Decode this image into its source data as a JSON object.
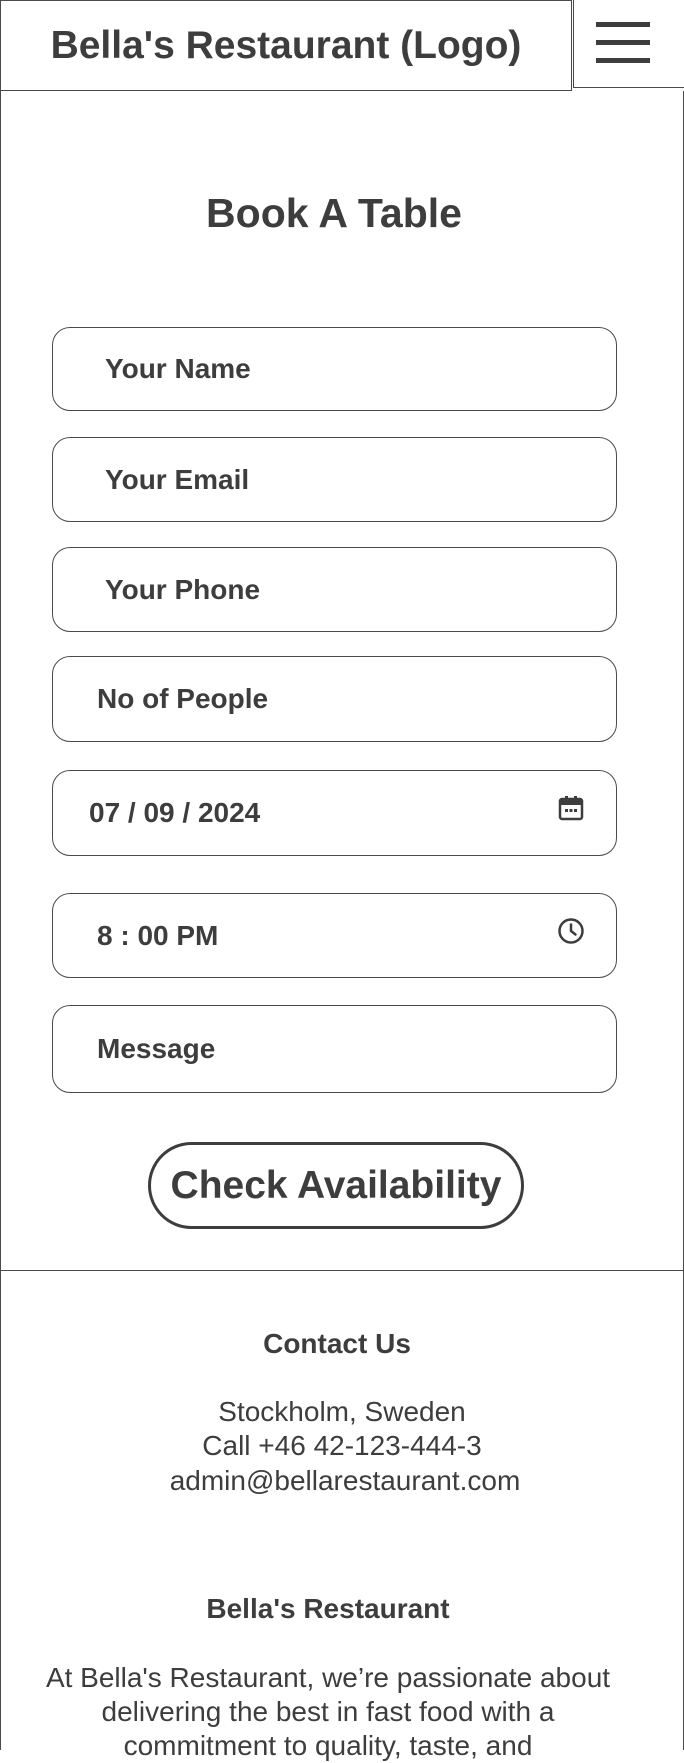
{
  "header": {
    "logo_text": "Bella's Restaurant (Logo)",
    "menu_icon": "hamburger-menu-icon"
  },
  "booking": {
    "title": "Book A Table",
    "fields": {
      "name": "Your Name",
      "email": "Your Email",
      "phone": "Your Phone",
      "people": "No of People",
      "date": "07 / 09 / 2024",
      "time": "8 : 00 PM",
      "message": "Message"
    },
    "date_icon": "calendar-icon",
    "time_icon": "clock-icon",
    "submit_label": "Check Availability"
  },
  "contact": {
    "heading": "Contact Us",
    "location": "Stockholm, Sweden",
    "phone": "Call +46 42-123-444-3",
    "email": "admin@bellarestaurant.com"
  },
  "about": {
    "heading": "Bella's Restaurant",
    "text": "At Bella's Restaurant, we’re passionate about delivering the best in fast food with a commitment to quality, taste, and"
  },
  "colors": {
    "text": "#3d3d3d",
    "border": "#4a4a4a",
    "background": "#ffffff"
  }
}
